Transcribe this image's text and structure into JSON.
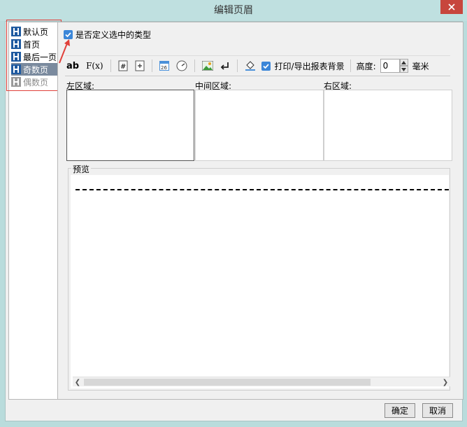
{
  "window": {
    "title": "编辑页眉"
  },
  "sidebar": {
    "items": [
      {
        "label": "默认页",
        "state": "normal"
      },
      {
        "label": "首页",
        "state": "normal"
      },
      {
        "label": "最后一页",
        "state": "normal"
      },
      {
        "label": "奇数页",
        "state": "selected"
      },
      {
        "label": "偶数页",
        "state": "disabled"
      }
    ]
  },
  "main": {
    "checkbox_label": "是否定义选中的类型",
    "toolbar": {
      "text_btn": "ab",
      "formula_btn": "F(x)",
      "print_bg_label": "打印/导出报表背景",
      "height_label": "高度:",
      "height_value": "0",
      "unit_label": "毫米"
    },
    "regions": {
      "left": "左区域:",
      "middle": "中间区域:",
      "right": "右区域:"
    },
    "preview_label": "预览"
  },
  "buttons": {
    "ok": "确定",
    "cancel": "取消"
  },
  "colors": {
    "accent": "#3b86d8",
    "selected_bg": "#7a8a9e",
    "highlight": "#e0403a",
    "close": "#c7463d"
  }
}
